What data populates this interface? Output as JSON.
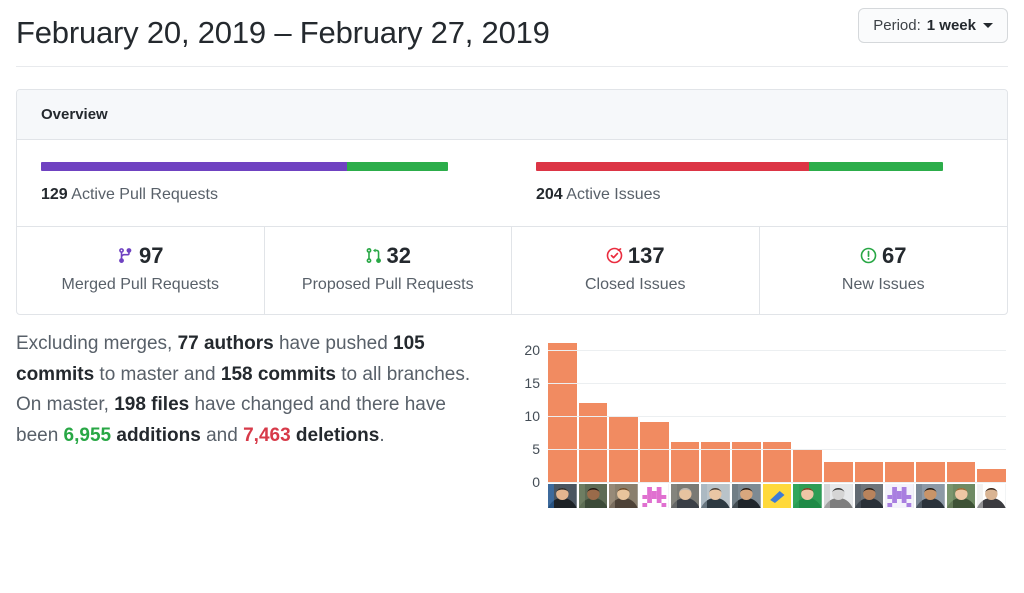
{
  "header": {
    "title": "February 20, 2019 – February 27, 2019",
    "period_label": "Period:",
    "period_value": "1 week"
  },
  "overview": {
    "card_title": "Overview",
    "pull_requests": {
      "count": "129",
      "label": "Active Pull Requests",
      "merged_pct": 75.2,
      "proposed_pct": 24.8,
      "merged_color": "#6f42c1",
      "proposed_color": "#2cad4a"
    },
    "issues": {
      "count": "204",
      "label": "Active Issues",
      "closed_pct": 67.2,
      "new_pct": 32.8,
      "closed_color": "#dc3545",
      "new_color": "#2cad4a"
    },
    "stats": [
      {
        "icon": "git-merge-icon",
        "value": "97",
        "label": "Merged Pull Requests",
        "color": "#6f42c1"
      },
      {
        "icon": "git-pull-request-icon",
        "value": "32",
        "label": "Proposed Pull Requests",
        "color": "#28a745"
      },
      {
        "icon": "issue-closed-icon",
        "value": "137",
        "label": "Closed Issues",
        "color": "#ea2d3f"
      },
      {
        "icon": "issue-opened-icon",
        "value": "67",
        "label": "New Issues",
        "color": "#28a745"
      }
    ]
  },
  "summary": {
    "text_1": "Excluding merges, ",
    "authors": "77 authors",
    "text_2": " have pushed ",
    "commits_master": "105 commits",
    "text_3": " to master and ",
    "commits_all": "158 commits",
    "text_4": " to all branches. On master, ",
    "files": "198 files",
    "text_5": " have changed and there have been ",
    "additions_num": "6,955",
    "additions_word": " additions",
    "text_6": " and ",
    "deletions_num": "7,463",
    "deletions_word": " deletions",
    "text_7": "."
  },
  "chart_data": {
    "type": "bar",
    "title": "",
    "xlabel": "",
    "ylabel": "",
    "ylim": [
      0,
      22
    ],
    "yticks": [
      0,
      5,
      10,
      15,
      20
    ],
    "ytick_labels": [
      "0",
      "5",
      "10",
      "15",
      "20"
    ],
    "grid": true,
    "legend": "none",
    "bar_color": "#f18b61",
    "categories": [
      "contributor-1",
      "contributor-2",
      "contributor-3",
      "contributor-4",
      "contributor-5",
      "contributor-6",
      "contributor-7",
      "contributor-8",
      "contributor-9",
      "contributor-10",
      "contributor-11",
      "contributor-12",
      "contributor-13",
      "contributor-14",
      "contributor-15"
    ],
    "values": [
      21,
      12,
      10,
      9,
      6,
      6,
      6,
      6,
      5,
      3,
      3,
      3,
      3,
      3,
      2
    ],
    "xtick_type": "avatar-images",
    "avatars": [
      {
        "kind": "photo",
        "bg": "#4a5560",
        "skin": "#e3b58f",
        "hair": "#2b2b2b",
        "shirt": "#1d2226",
        "accent": "#2f7fd8"
      },
      {
        "kind": "photo",
        "bg": "#5e6b55",
        "skin": "#9a6b4a",
        "hair": "#201814",
        "shirt": "#3c4a38",
        "accent": "#7d9070"
      },
      {
        "kind": "photo",
        "bg": "#8a7f6d",
        "skin": "#e8c49c",
        "hair": "#6b4a2a",
        "shirt": "#4d4237",
        "accent": "#a39684"
      },
      {
        "kind": "identicon",
        "bg": "#ffffff",
        "fg": "#e070d0"
      },
      {
        "kind": "photo",
        "bg": "#7a7a74",
        "skin": "#e6c3a0",
        "hair": "#b9b4ae",
        "shirt": "#3a3f46",
        "accent": "#8d8d86"
      },
      {
        "kind": "photo",
        "bg": "#b9c3c9",
        "skin": "#e9c6a4",
        "hair": "#4a4038",
        "shirt": "#2e3a42",
        "accent": "#9fb0bb"
      },
      {
        "kind": "photo",
        "bg": "#7d8a93",
        "skin": "#d8a77e",
        "hair": "#241a14",
        "shirt": "#20262b",
        "accent": "#66727a"
      },
      {
        "kind": "emoji",
        "bg": "#ffd93b",
        "fg": "#3d7bd6"
      },
      {
        "kind": "photo",
        "bg": "#2e9d55",
        "skin": "#eec6a6",
        "hair": "#7d3f22",
        "shirt": "#1f8a46",
        "accent": "#36b062"
      },
      {
        "kind": "photo",
        "bg": "#e6e8ea",
        "skin": "#d5d5d5",
        "hair": "#3a3a3a",
        "shirt": "#7e7e7e",
        "accent": "#c4c4c4"
      },
      {
        "kind": "photo",
        "bg": "#6e747a",
        "skin": "#b9835c",
        "hair": "#241c16",
        "shirt": "#2a3138",
        "accent": "#566069"
      },
      {
        "kind": "identicon",
        "bg": "#f4f2fb",
        "fg": "#a97fe0"
      },
      {
        "kind": "photo",
        "bg": "#8d99a6",
        "skin": "#c99468",
        "hair": "#211a15",
        "shirt": "#2b333b",
        "accent": "#6d7b88"
      },
      {
        "kind": "photo",
        "bg": "#6f8a63",
        "skin": "#eec7a4",
        "hair": "#9a6a34",
        "shirt": "#3e5236",
        "accent": "#87a178"
      },
      {
        "kind": "photo",
        "bg": "#ffffff",
        "skin": "#d9b493",
        "hair": "#3a2a20",
        "shirt": "#3b3b3f",
        "accent": "#e4e4e4"
      }
    ]
  }
}
